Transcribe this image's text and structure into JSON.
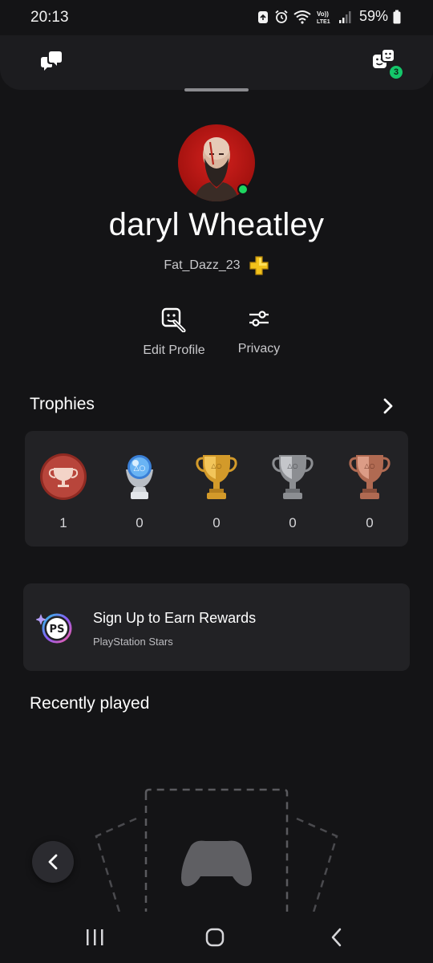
{
  "status_bar": {
    "time": "20:13",
    "network_label": "Vo)) LTE1",
    "battery": "59%"
  },
  "header": {
    "left_icon": "chat-bubbles-icon",
    "right_icon": "friends-icon",
    "notification_count": "3",
    "badge_color": "#14c76a"
  },
  "profile": {
    "display_name": "daryl Wheatley",
    "online_id": "Fat_Dazz_23",
    "plus_icon": "playstation-plus-icon",
    "online_status_color": "#1ed760",
    "actions": [
      {
        "label": "Edit Profile",
        "icon": "edit-profile-icon"
      },
      {
        "label": "Privacy",
        "icon": "sliders-icon"
      }
    ]
  },
  "trophies": {
    "title": "Trophies",
    "items": [
      {
        "type": "level",
        "count": "1"
      },
      {
        "type": "platinum",
        "count": "0"
      },
      {
        "type": "gold",
        "count": "0"
      },
      {
        "type": "silver",
        "count": "0"
      },
      {
        "type": "bronze",
        "count": "0"
      }
    ]
  },
  "stars_banner": {
    "title": "Sign Up to Earn Rewards",
    "subtitle": "PlayStation Stars",
    "icon": "playstation-stars-icon"
  },
  "recently_played": {
    "title": "Recently played"
  },
  "nav_bar": {
    "buttons": [
      "recents-icon",
      "home-icon",
      "back-icon"
    ]
  }
}
